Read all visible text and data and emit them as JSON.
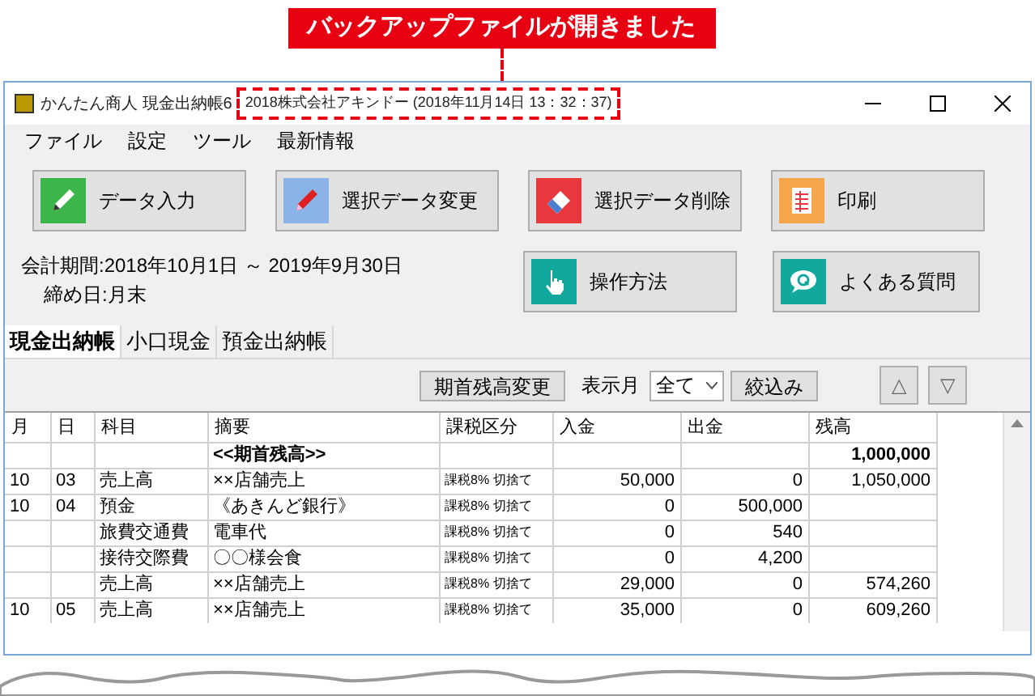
{
  "callout": "バックアップファイルが開きました",
  "window": {
    "app_title": "かんたん商人 現金出納帳6",
    "file_title": "2018株式会社アキンドー (2018年11月14日 13：32：37)"
  },
  "menu": [
    "ファイル",
    "設定",
    "ツール",
    "最新情報"
  ],
  "buttons": [
    {
      "label": "データ入力",
      "kind": "pencil",
      "color": "#3cb54a"
    },
    {
      "label": "選択データ変更",
      "kind": "pen",
      "color": "#8ab4e8"
    },
    {
      "label": "選択データ削除",
      "kind": "eraser",
      "color": "#e8383d"
    },
    {
      "label": "印刷",
      "kind": "sheet",
      "color": "#f5a54a"
    },
    {
      "label": "操作方法",
      "kind": "hand",
      "color": "#13a89e"
    },
    {
      "label": "よくある質問",
      "kind": "question",
      "color": "#13a89e"
    }
  ],
  "period": "会計期間:2018年10月1日 ～ 2019年9月30日",
  "closing": "締め日:月末",
  "tabs": [
    {
      "label": "現金出納帳",
      "selected": true
    },
    {
      "label": "小口現金",
      "selected": false
    },
    {
      "label": "預金出納帳",
      "selected": false
    }
  ],
  "filter": {
    "balance_button": "期首残高変更",
    "month_label": "表示月",
    "month_value": "全て",
    "apply_button": "絞込み",
    "up_button": "△",
    "down_button": "▽"
  },
  "table": {
    "columns": [
      "月",
      "日",
      "科目",
      "摘要",
      "課税区分",
      "入金",
      "出金",
      "残高"
    ],
    "rows": [
      {
        "kind": "opening",
        "cells": [
          "",
          "",
          "",
          "<<期首残高>>",
          "",
          "",
          "",
          "1,000,000"
        ]
      },
      {
        "kind": "entry",
        "cells": [
          "10",
          "03",
          "売上高",
          "××店舗売上",
          "課税8% 切捨て",
          "50,000",
          "0",
          "1,050,000"
        ]
      },
      {
        "kind": "entry",
        "cells": [
          "10",
          "04",
          "預金",
          "《あきんど銀行》",
          "課税8% 切捨て",
          "0",
          "500,000",
          ""
        ]
      },
      {
        "kind": "entry",
        "cells": [
          "",
          "",
          "旅費交通費",
          "電車代",
          "課税8% 切捨て",
          "0",
          "540",
          ""
        ]
      },
      {
        "kind": "entry",
        "cells": [
          "",
          "",
          "接待交際費",
          "〇〇様会食",
          "課税8% 切捨て",
          "0",
          "4,200",
          ""
        ]
      },
      {
        "kind": "entry",
        "cells": [
          "",
          "",
          "売上高",
          "××店舗売上",
          "課税8% 切捨て",
          "29,000",
          "0",
          "574,260"
        ]
      },
      {
        "kind": "entry",
        "cells": [
          "10",
          "05",
          "売上高",
          "××店舗売上",
          "課税8% 切捨て",
          "35,000",
          "0",
          "609,260"
        ]
      }
    ]
  }
}
